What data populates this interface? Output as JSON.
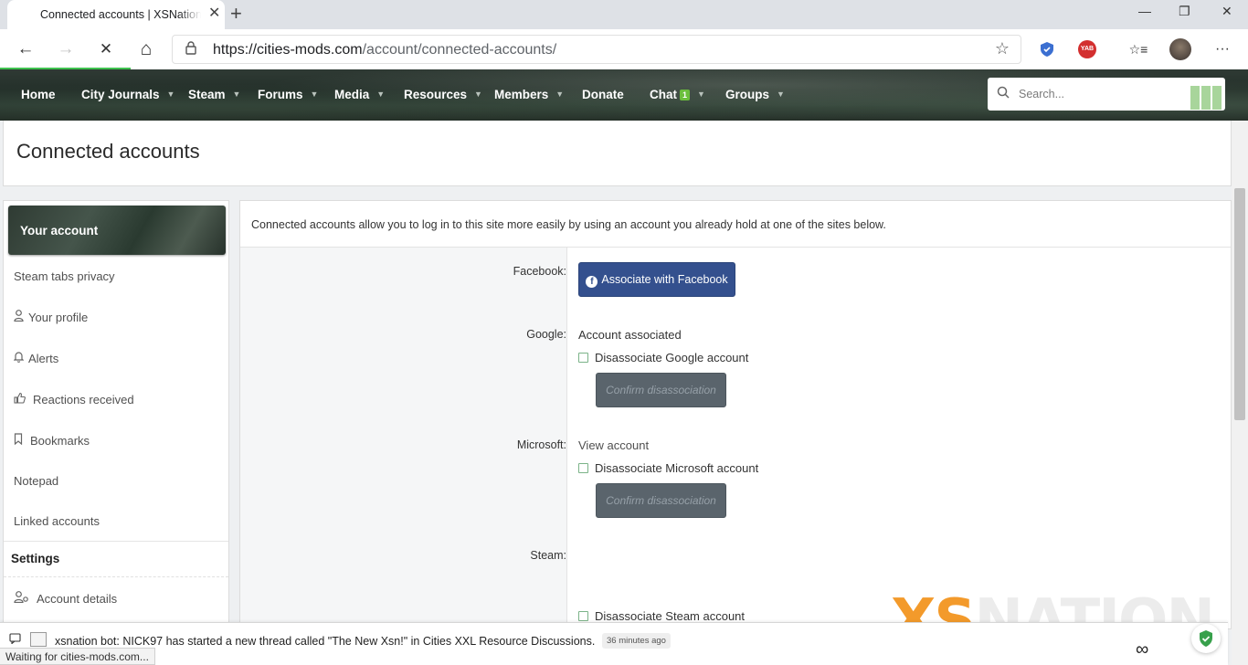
{
  "browser": {
    "tab_title": "Connected accounts | XSNation - Cities XXL Mods",
    "tab_close": "✕",
    "new_tab": "+",
    "window_controls": [
      "—",
      "❐",
      "✕"
    ],
    "url_host": "https://cities-mods.com",
    "url_path": "/account/connected-accounts/",
    "buttons": {
      "back": "←",
      "forward": "→",
      "stop": "✕",
      "home": "⌂",
      "star": "☆",
      "favorites": "☆≡",
      "more": "···"
    },
    "extension_label": "YAB",
    "status_text": "Waiting for cities-mods.com..."
  },
  "nav": {
    "items": [
      {
        "label": "Home",
        "caret": false
      },
      {
        "label": "City Journals",
        "caret": true
      },
      {
        "label": "Steam",
        "caret": true
      },
      {
        "label": "Forums",
        "caret": true
      },
      {
        "label": "Media",
        "caret": true
      },
      {
        "label": "Resources",
        "caret": true
      },
      {
        "label": "Members",
        "caret": true
      },
      {
        "label": "Donate",
        "caret": false
      },
      {
        "label": "Chat",
        "caret": true,
        "badge": "1"
      },
      {
        "label": "Groups",
        "caret": true
      }
    ],
    "search_placeholder": "Search..."
  },
  "page": {
    "title": "Connected accounts"
  },
  "sidebar": {
    "account_header": "Your account",
    "items": [
      {
        "label": "Steam tabs privacy",
        "icon": ""
      },
      {
        "label": "Your profile",
        "icon": "user-icon"
      },
      {
        "label": "Alerts",
        "icon": "bell-icon"
      },
      {
        "label": "Reactions received",
        "icon": "thumbs-up-icon"
      },
      {
        "label": "Bookmarks",
        "icon": "bookmark-icon"
      },
      {
        "label": "Notepad",
        "icon": ""
      },
      {
        "label": "Linked accounts",
        "icon": ""
      }
    ],
    "settings_header": "Settings",
    "settings_items": [
      {
        "label": "Account details",
        "icon": "user-gear-icon"
      }
    ]
  },
  "main": {
    "intro": "Connected accounts allow you to log in to this site more easily by using an account you already hold at one of the sites below.",
    "facebook": {
      "label": "Facebook:",
      "button": "Associate with Facebook"
    },
    "google": {
      "label": "Google:",
      "status": "Account associated",
      "checkbox": "Disassociate Google account",
      "confirm": "Confirm disassociation"
    },
    "microsoft": {
      "label": "Microsoft:",
      "status": "View account",
      "checkbox": "Disassociate Microsoft account",
      "confirm": "Confirm disassociation"
    },
    "steam": {
      "label": "Steam:",
      "checkbox": "Disassociate Steam account"
    }
  },
  "watermark": {
    "accent": "XS",
    "rest": "NATION"
  },
  "notification": {
    "message": "xsnation bot: NICK97 has started a new thread called \"The New Xsn!\" in Cities XXL Resource Discussions.",
    "time": "36 minutes ago"
  },
  "colors": {
    "facebook": "#34508e",
    "nav_bg": "#2b3730",
    "badge": "#6bbf3c",
    "accent": "#f39a2b"
  }
}
